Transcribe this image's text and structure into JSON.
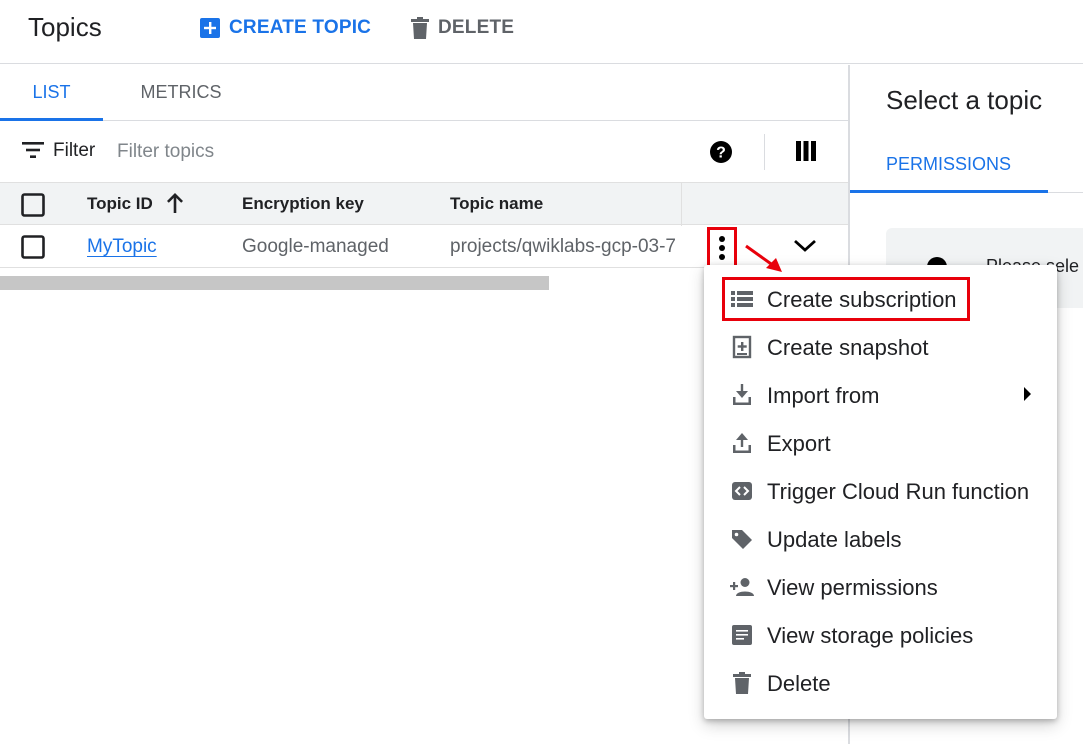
{
  "header": {
    "title": "Topics",
    "create_label": "CREATE TOPIC",
    "delete_label": "DELETE"
  },
  "tabs": {
    "list": "LIST",
    "metrics": "METRICS"
  },
  "filter": {
    "label": "Filter",
    "placeholder": "Filter topics"
  },
  "table": {
    "columns": [
      "Topic ID",
      "Encryption key",
      "Topic name"
    ],
    "rows": [
      {
        "topic_id": "MyTopic",
        "encryption_key": "Google-managed",
        "topic_name": "projects/qwiklabs-gcp-03-7"
      }
    ]
  },
  "side_panel": {
    "title": "Select a topic",
    "tab": "PERMISSIONS",
    "info_text": "Please sele"
  },
  "context_menu": {
    "items": [
      {
        "label": "Create subscription",
        "icon": "list-icon"
      },
      {
        "label": "Create snapshot",
        "icon": "snapshot-icon"
      },
      {
        "label": "Import from",
        "icon": "download-icon"
      },
      {
        "label": "Export",
        "icon": "upload-icon"
      },
      {
        "label": "Trigger Cloud Run function",
        "icon": "code-icon"
      },
      {
        "label": "Update labels",
        "icon": "label-icon"
      },
      {
        "label": "View permissions",
        "icon": "person-add-icon"
      },
      {
        "label": "View storage policies",
        "icon": "article-icon"
      },
      {
        "label": "Delete",
        "icon": "trash-icon"
      }
    ]
  },
  "colors": {
    "accent": "#1a73e8",
    "highlight": "#e8000b",
    "text_secondary": "#5f6368"
  }
}
